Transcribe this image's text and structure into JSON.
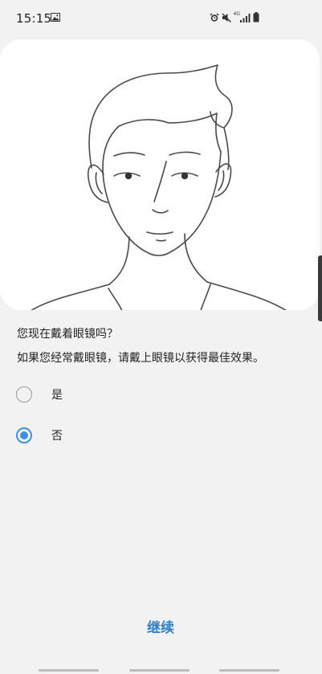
{
  "status_bar": {
    "time": "15:15",
    "network_type": "4G",
    "icons": [
      "gallery-icon",
      "alarm-icon",
      "mute-icon",
      "signal-icon",
      "battery-icon"
    ]
  },
  "illustration": {
    "subject": "face-outline-icon"
  },
  "question": "您现在戴着眼镜吗？",
  "hint": "如果您经常戴眼镜，请戴上眼镜以获得最佳效果。",
  "options": [
    {
      "label": "是",
      "selected": false
    },
    {
      "label": "否",
      "selected": true
    }
  ],
  "continue_label": "继续",
  "colors": {
    "background": "#f2f2f2",
    "card": "#ffffff",
    "accent": "#3e91e0",
    "button_text": "#2f80c6"
  }
}
